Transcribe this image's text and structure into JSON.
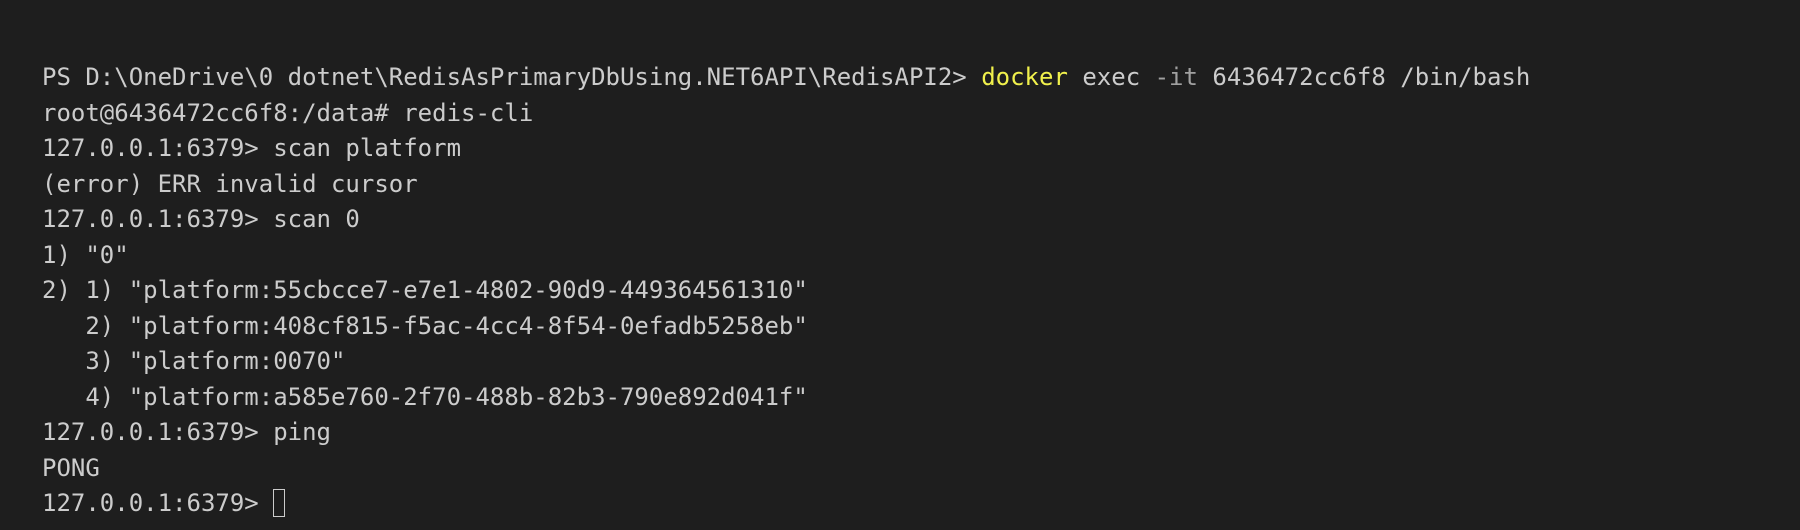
{
  "terminal": {
    "line1": {
      "prompt": "PS D:\\OneDrive\\0 dotnet\\RedisAsPrimaryDbUsing.NET6API\\RedisAPI2> ",
      "command": "docker",
      "arg1": " exec ",
      "flag": "-it",
      "args": " 6436472cc6f8 /bin/bash"
    },
    "lines": [
      "root@6436472cc6f8:/data# redis-cli",
      "127.0.0.1:6379> scan platform",
      "(error) ERR invalid cursor",
      "127.0.0.1:6379> scan 0",
      "1) \"0\"",
      "2) 1) \"platform:55cbcce7-e7e1-4802-90d9-449364561310\"",
      "   2) \"platform:408cf815-f5ac-4cc4-8f54-0efadb5258eb\"",
      "   3) \"platform:0070\"",
      "   4) \"platform:a585e760-2f70-488b-82b3-790e892d041f\"",
      "127.0.0.1:6379> ping",
      "PONG"
    ],
    "last_prompt": "127.0.0.1:6379> ",
    "colors": {
      "background": "#1e1e1e",
      "foreground": "#cccccc",
      "command": "#f1f14c",
      "flag": "#a0a0a0"
    }
  }
}
